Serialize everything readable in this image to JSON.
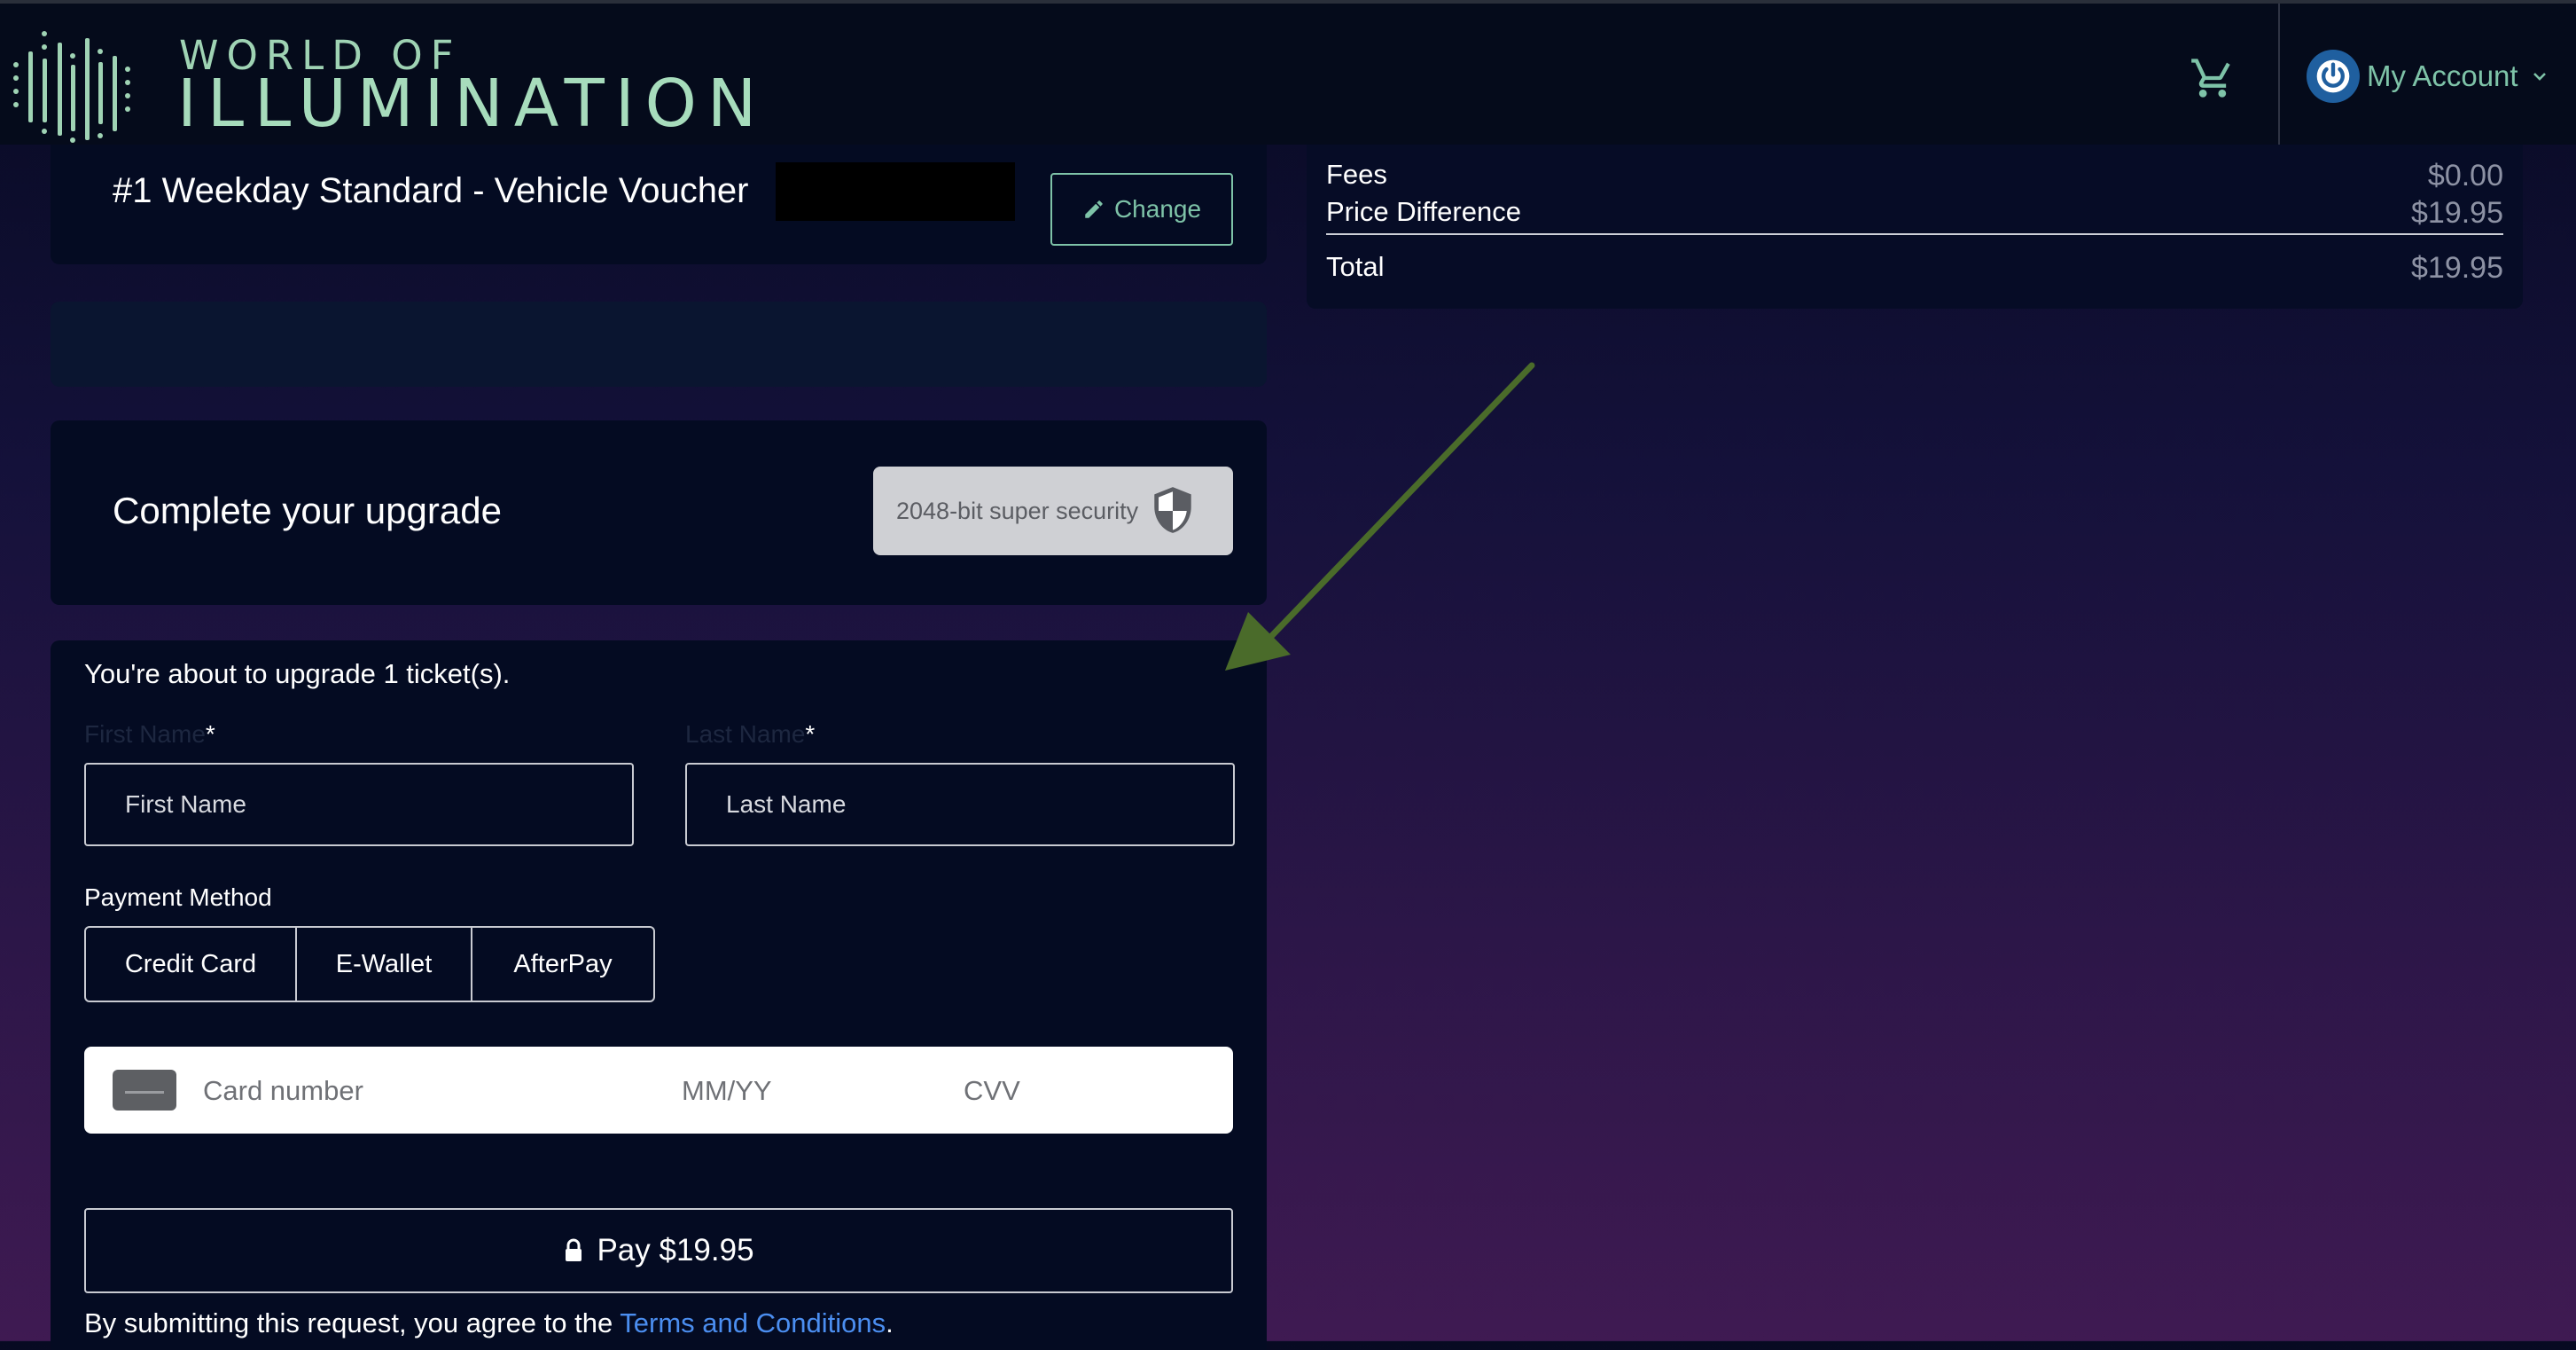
{
  "brand": {
    "line1": "WORLD OF",
    "line2": "ILLUMINATION",
    "colors": {
      "logo": "#a7dcbc",
      "accent": "#7ec3a8"
    }
  },
  "header": {
    "cart_icon": "cart-icon",
    "account_label": "My Account",
    "account_icon": "power-icon"
  },
  "voucher": {
    "title": "#1 Weekday Standard - Vehicle Voucher",
    "change_label": "Change"
  },
  "complete": {
    "title": "Complete your upgrade",
    "security_label": "2048-bit super security"
  },
  "form": {
    "message": "You're about to upgrade 1 ticket(s).",
    "first_name_label": "First Name",
    "last_name_label": "Last Name",
    "required_mark": "*",
    "first_name_placeholder": "First Name",
    "last_name_placeholder": "Last Name",
    "payment_method_label": "Payment Method",
    "payment_methods": [
      "Credit Card",
      "E-Wallet",
      "AfterPay"
    ],
    "card_number_placeholder": "Card number",
    "expiry_placeholder": "MM/YY",
    "cvv_placeholder": "CVV",
    "pay_label": "Pay $19.95",
    "terms_prefix": "By submitting this request, you agree to the ",
    "terms_link": "Terms and Conditions",
    "terms_suffix": "."
  },
  "summary": {
    "fees_label": "Fees",
    "fees_value": "$0.00",
    "diff_label": "Price Difference",
    "diff_value": "$19.95",
    "total_label": "Total",
    "total_value": "$19.95"
  },
  "annotation": {
    "color": "#4a6b2a"
  }
}
